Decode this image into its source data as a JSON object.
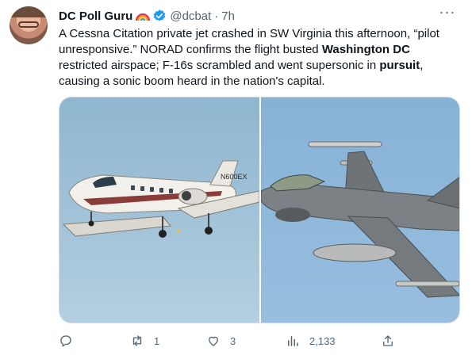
{
  "author": {
    "name": "DC Poll Guru",
    "handle": "@dcbat",
    "separator": "·",
    "time": "7h",
    "icons": [
      "rainbow-emoji",
      "verified-badge-icon"
    ]
  },
  "tweet": {
    "segments": [
      {
        "text": "A Cessna Citation private jet crashed in SW Virginia this afternoon, “pilot unresponsive.” NORAD confirms the flight busted ",
        "bold": false
      },
      {
        "text": "Washington DC",
        "bold": true
      },
      {
        "text": " restricted airspace; F-16s scrambled and went supersonic in ",
        "bold": false
      },
      {
        "text": "pursuit",
        "bold": true
      },
      {
        "text": ", causing a sonic boom heard in the nation's capital.",
        "bold": false
      }
    ]
  },
  "media": {
    "left_tail_number": "N600EX"
  },
  "actions": {
    "reply_count": "",
    "retweet_count": "1",
    "like_count": "3",
    "views_count": "2,133"
  }
}
